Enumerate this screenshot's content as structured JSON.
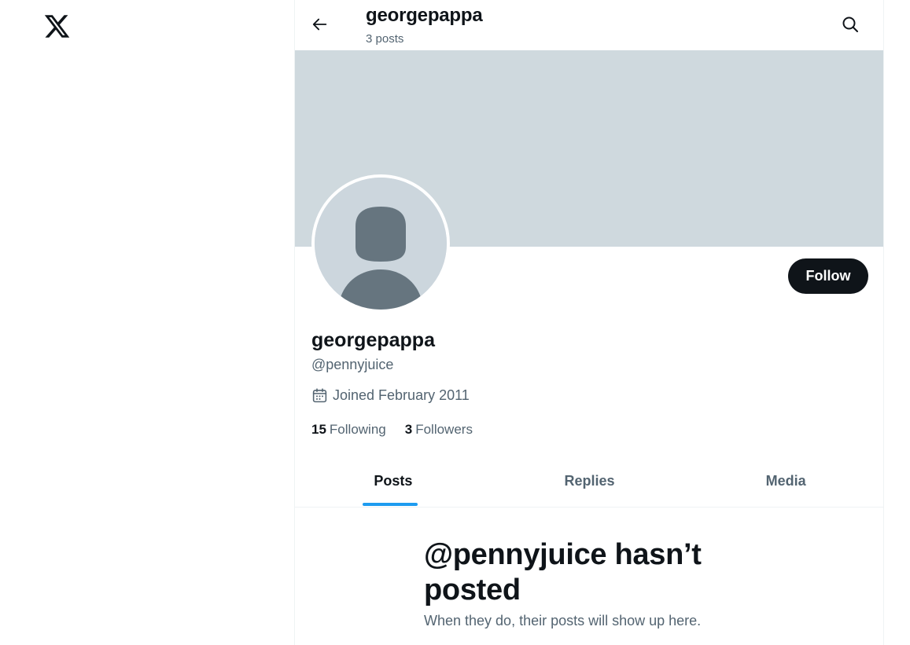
{
  "header": {
    "name": "georgepappa",
    "post_count": "3 posts"
  },
  "profile": {
    "display_name": "georgepappa",
    "handle": "@pennyjuice",
    "joined": "Joined February 2011",
    "following_count": "15",
    "following_label": "Following",
    "followers_count": "3",
    "followers_label": "Followers",
    "follow_label": "Follow"
  },
  "tabs": [
    {
      "label": "Posts",
      "active": true
    },
    {
      "label": "Replies",
      "active": false
    },
    {
      "label": "Media",
      "active": false
    }
  ],
  "empty_state": {
    "title": "@pennyjuice hasn’t posted",
    "subtitle": "When they do, their posts will show up here."
  },
  "icons": {
    "logo": "x-logo-icon",
    "back": "arrow-left-icon",
    "search": "search-icon",
    "calendar": "calendar-icon"
  },
  "colors": {
    "text": "#0f1419",
    "secondary": "#536471",
    "banner": "#cfd9de",
    "accent": "#1d9bf0",
    "follow_bg": "#0f1419"
  }
}
